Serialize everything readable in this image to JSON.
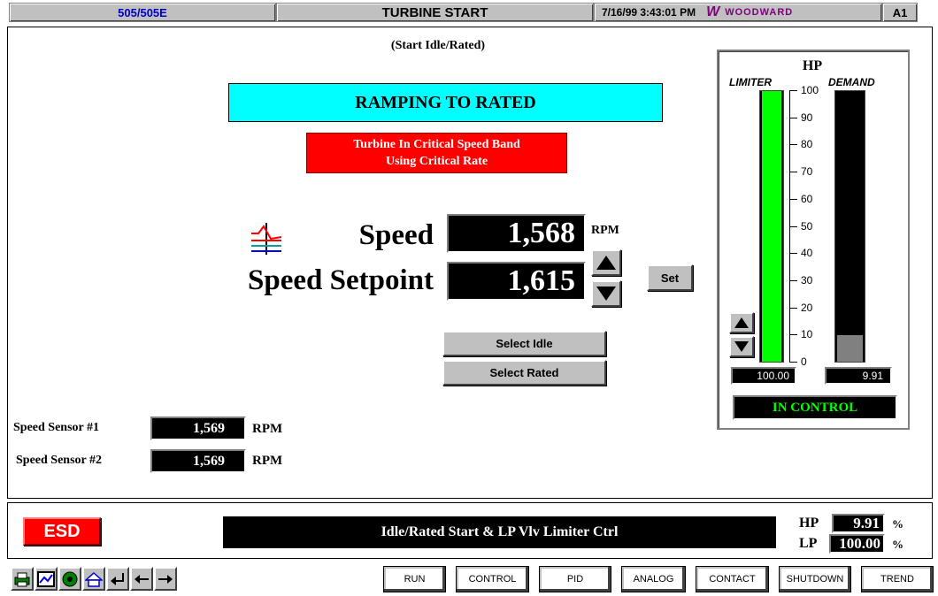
{
  "title_bar": {
    "model": "505/505E",
    "screen": "TURBINE START",
    "datetime": "7/16/99 3:43:01 PM",
    "brand": "WOODWARD",
    "alarm_code": "A1"
  },
  "mode": "(Start Idle/Rated)",
  "status_banner": "RAMPING TO RATED",
  "warning": {
    "line1": "Turbine In Critical Speed Band",
    "line2": "Using Critical Rate"
  },
  "speed": {
    "label": "Speed",
    "value": "1,568",
    "unit": "RPM",
    "setpoint_label": "Speed Setpoint",
    "setpoint_value": "1,615",
    "set_button": "Set"
  },
  "buttons": {
    "select_idle": "Select Idle",
    "select_rated": "Select Rated"
  },
  "sensors": [
    {
      "label": "Speed Sensor #1",
      "value": "1,569",
      "unit": "RPM"
    },
    {
      "label": "Speed Sensor #2",
      "value": "1,569",
      "unit": "RPM"
    }
  ],
  "hp_panel": {
    "title": "HP",
    "limiter_label": "LIMITER",
    "demand_label": "DEMAND",
    "scale": [
      "100",
      "90",
      "80",
      "70",
      "60",
      "50",
      "40",
      "30",
      "20",
      "10",
      "0"
    ],
    "limiter_value": "100.00",
    "demand_value": "9.91",
    "limiter_level_percent": 100.0,
    "demand_level_percent": 9.91,
    "status": "IN CONTROL"
  },
  "bottom_bar": {
    "esd": "ESD",
    "message": "Idle/Rated Start &  LP Vlv Limiter Ctrl",
    "hp_label": "HP",
    "hp_value": "9.91",
    "lp_label": "LP",
    "lp_value": "100.00",
    "unit": "%"
  },
  "nav": [
    "RUN",
    "CONTROL",
    "PID",
    "ANALOG",
    "CONTACT",
    "SHUTDOWN",
    "TREND"
  ],
  "colors": {
    "banner": "#00ffff",
    "warning": "#ff0000",
    "limiter_bar": "#00ff00",
    "demand_bar": "#808080",
    "status_text": "#00ff00",
    "esd": "#ff0000",
    "model_text": "#0000cc"
  }
}
